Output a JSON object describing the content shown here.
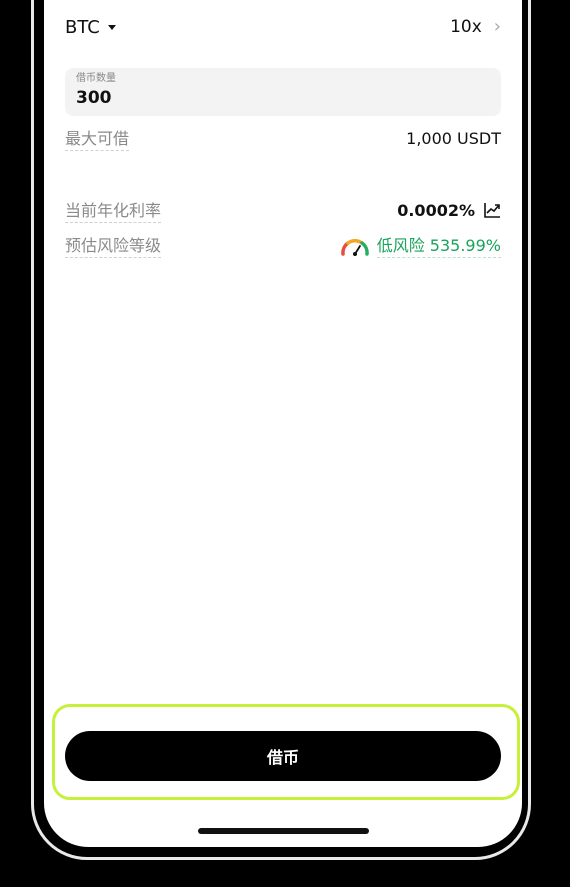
{
  "asset": {
    "name": "BTC",
    "leverage": "10x"
  },
  "amount": {
    "label": "借币数量",
    "value": "300"
  },
  "max_borrow": {
    "label": "最大可借",
    "value": "1,000 USDT"
  },
  "annual_rate": {
    "label": "当前年化利率",
    "value": "0.0002%"
  },
  "risk": {
    "label": "预估风险等级",
    "level_text": "低风险 535.99%"
  },
  "borrow_button": {
    "label": "借币"
  },
  "icons": {
    "asset_dropdown": "caret-down-icon",
    "leverage": "chevron-right-icon",
    "rate_chart": "trend-chart-icon",
    "risk_gauge": "gauge-icon"
  },
  "colors": {
    "accent_highlight": "#c6f03a",
    "risk_low": "#1aa35c",
    "primary_button": "#000000"
  }
}
